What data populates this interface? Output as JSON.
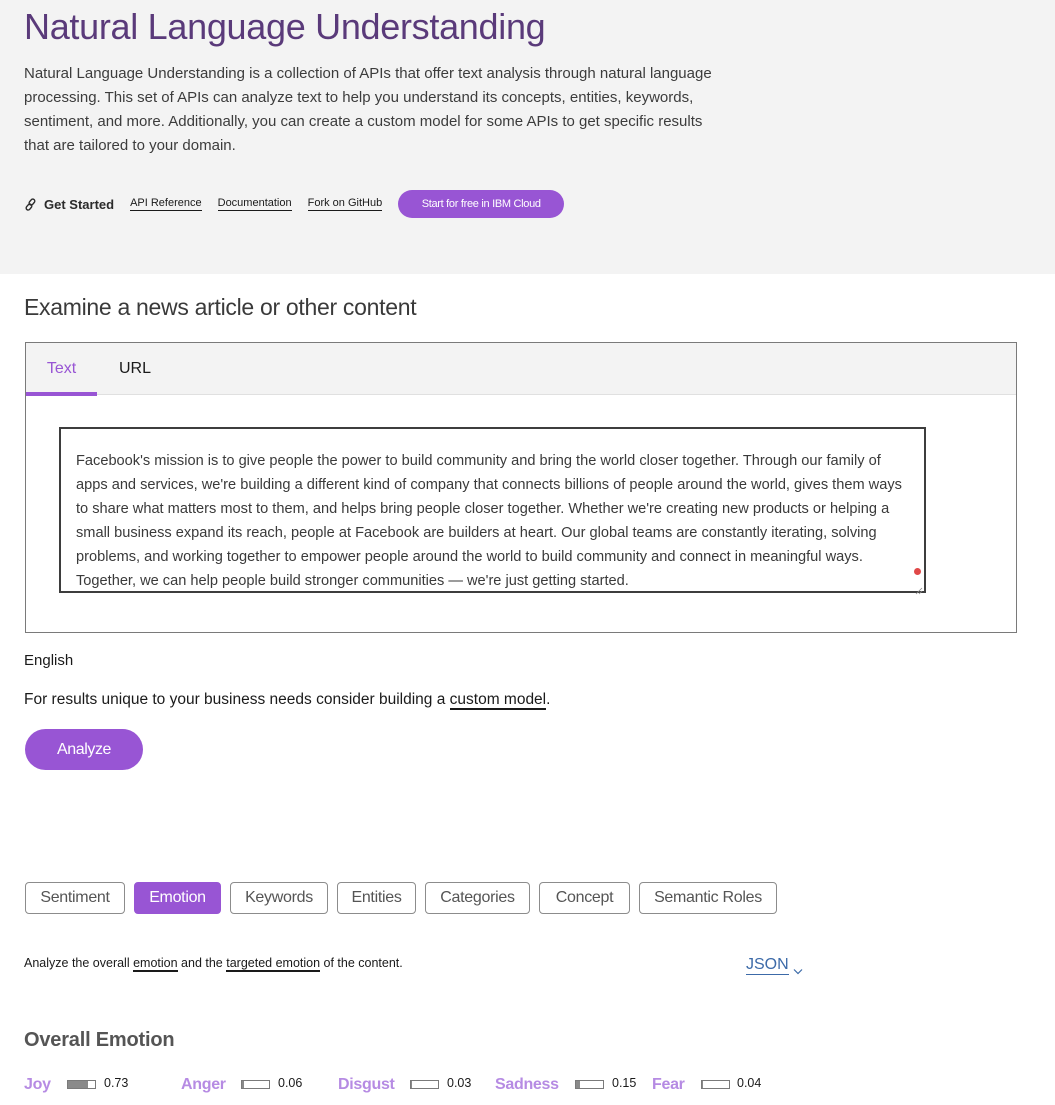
{
  "hero": {
    "title": "Natural Language Understanding",
    "description": "Natural Language Understanding is a collection of APIs that offer text analysis through natural language processing. This set of APIs can analyze text to help you understand its concepts, entities, keywords, sentiment, and more. Additionally, you can create a custom model for some APIs to get specific results that are tailored to your domain.",
    "get_started_icon": "link-icon",
    "get_started_label": "Get Started",
    "links": [
      "API Reference",
      "Documentation",
      "Fork on GitHub"
    ],
    "cta_label": "Start for free in IBM Cloud"
  },
  "input": {
    "section_title": "Examine a news article or other content",
    "tabs": [
      {
        "label": "Text",
        "active": true
      },
      {
        "label": "URL",
        "active": false
      }
    ],
    "text_value": "Facebook's mission is to give people the power to build community and bring the world closer together. Through our family of apps and services, we're building a different kind of company that connects billions of people around the world, gives them ways to share what matters most to them, and helps bring people closer together. Whether we're creating new products or helping a small business expand its reach, people at Facebook are builders at heart. Our global teams are constantly iterating, solving problems, and working together to empower people around the world to build community and connect in meaningful ways. Together, we can help people build stronger communities — we're just getting started.",
    "language": "English",
    "custom_prefix": "For results unique to your business needs consider building a ",
    "custom_link": "custom model",
    "custom_suffix": ".",
    "analyze_label": "Analyze"
  },
  "results": {
    "feature_tabs": [
      {
        "label": "Sentiment",
        "active": false
      },
      {
        "label": "Emotion",
        "active": true
      },
      {
        "label": "Keywords",
        "active": false
      },
      {
        "label": "Entities",
        "active": false
      },
      {
        "label": "Categories",
        "active": false
      },
      {
        "label": "Concept",
        "active": false
      },
      {
        "label": "Semantic Roles",
        "active": false
      }
    ],
    "desc_prefix": "Analyze the overall ",
    "desc_link1": "emotion",
    "desc_middle": " and the ",
    "desc_link2": "targeted emotion",
    "desc_suffix": " of the content.",
    "json_label": "JSON",
    "json_icon": "chevron-down-icon",
    "overall_title": "Overall Emotion",
    "emotions": [
      {
        "label": "Joy",
        "value": "0.73",
        "score": 0.73
      },
      {
        "label": "Anger",
        "value": "0.06",
        "score": 0.06
      },
      {
        "label": "Disgust",
        "value": "0.03",
        "score": 0.03
      },
      {
        "label": "Sadness",
        "value": "0.15",
        "score": 0.15
      },
      {
        "label": "Fear",
        "value": "0.04",
        "score": 0.04
      }
    ]
  },
  "colors": {
    "accent": "#9855d4",
    "title": "#5a3a7a",
    "emotion_label": "#b68be3",
    "json_link": "#3c6aa8",
    "hero_bg": "#f3f3f3",
    "error_dot": "#e04848"
  }
}
